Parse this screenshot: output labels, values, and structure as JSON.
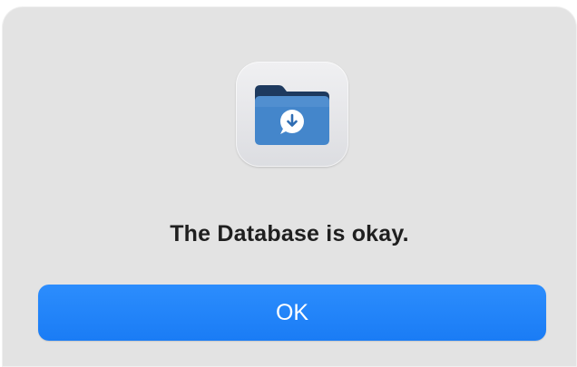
{
  "dialog": {
    "icon": "folder-download-icon",
    "message": "The Database is okay.",
    "ok_label": "OK"
  },
  "colors": {
    "dialog_background": "#e3e3e3",
    "button_accent": "#1d80f8",
    "folder_blue": "#3f7fc3",
    "folder_dark": "#1e3a5f"
  }
}
